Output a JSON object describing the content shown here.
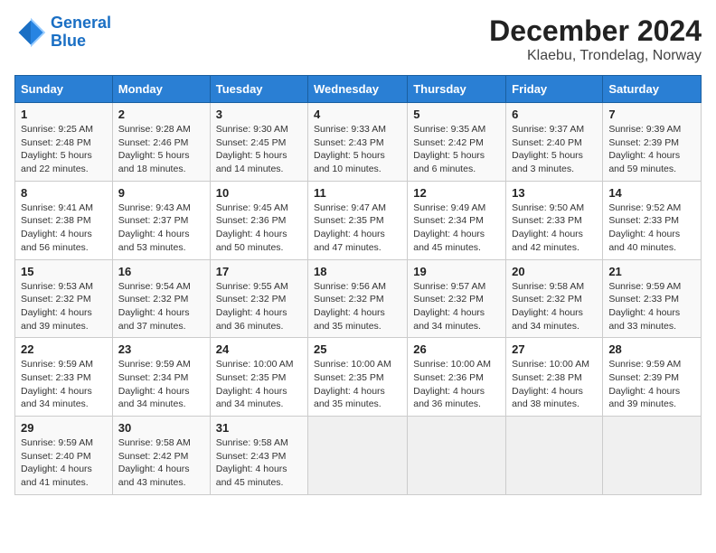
{
  "header": {
    "logo_line1": "General",
    "logo_line2": "Blue",
    "title": "December 2024",
    "subtitle": "Klaebu, Trondelag, Norway"
  },
  "columns": [
    "Sunday",
    "Monday",
    "Tuesday",
    "Wednesday",
    "Thursday",
    "Friday",
    "Saturday"
  ],
  "weeks": [
    [
      {
        "day": "1",
        "sunrise": "Sunrise: 9:25 AM",
        "sunset": "Sunset: 2:48 PM",
        "daylight": "Daylight: 5 hours and 22 minutes."
      },
      {
        "day": "2",
        "sunrise": "Sunrise: 9:28 AM",
        "sunset": "Sunset: 2:46 PM",
        "daylight": "Daylight: 5 hours and 18 minutes."
      },
      {
        "day": "3",
        "sunrise": "Sunrise: 9:30 AM",
        "sunset": "Sunset: 2:45 PM",
        "daylight": "Daylight: 5 hours and 14 minutes."
      },
      {
        "day": "4",
        "sunrise": "Sunrise: 9:33 AM",
        "sunset": "Sunset: 2:43 PM",
        "daylight": "Daylight: 5 hours and 10 minutes."
      },
      {
        "day": "5",
        "sunrise": "Sunrise: 9:35 AM",
        "sunset": "Sunset: 2:42 PM",
        "daylight": "Daylight: 5 hours and 6 minutes."
      },
      {
        "day": "6",
        "sunrise": "Sunrise: 9:37 AM",
        "sunset": "Sunset: 2:40 PM",
        "daylight": "Daylight: 5 hours and 3 minutes."
      },
      {
        "day": "7",
        "sunrise": "Sunrise: 9:39 AM",
        "sunset": "Sunset: 2:39 PM",
        "daylight": "Daylight: 4 hours and 59 minutes."
      }
    ],
    [
      {
        "day": "8",
        "sunrise": "Sunrise: 9:41 AM",
        "sunset": "Sunset: 2:38 PM",
        "daylight": "Daylight: 4 hours and 56 minutes."
      },
      {
        "day": "9",
        "sunrise": "Sunrise: 9:43 AM",
        "sunset": "Sunset: 2:37 PM",
        "daylight": "Daylight: 4 hours and 53 minutes."
      },
      {
        "day": "10",
        "sunrise": "Sunrise: 9:45 AM",
        "sunset": "Sunset: 2:36 PM",
        "daylight": "Daylight: 4 hours and 50 minutes."
      },
      {
        "day": "11",
        "sunrise": "Sunrise: 9:47 AM",
        "sunset": "Sunset: 2:35 PM",
        "daylight": "Daylight: 4 hours and 47 minutes."
      },
      {
        "day": "12",
        "sunrise": "Sunrise: 9:49 AM",
        "sunset": "Sunset: 2:34 PM",
        "daylight": "Daylight: 4 hours and 45 minutes."
      },
      {
        "day": "13",
        "sunrise": "Sunrise: 9:50 AM",
        "sunset": "Sunset: 2:33 PM",
        "daylight": "Daylight: 4 hours and 42 minutes."
      },
      {
        "day": "14",
        "sunrise": "Sunrise: 9:52 AM",
        "sunset": "Sunset: 2:33 PM",
        "daylight": "Daylight: 4 hours and 40 minutes."
      }
    ],
    [
      {
        "day": "15",
        "sunrise": "Sunrise: 9:53 AM",
        "sunset": "Sunset: 2:32 PM",
        "daylight": "Daylight: 4 hours and 39 minutes."
      },
      {
        "day": "16",
        "sunrise": "Sunrise: 9:54 AM",
        "sunset": "Sunset: 2:32 PM",
        "daylight": "Daylight: 4 hours and 37 minutes."
      },
      {
        "day": "17",
        "sunrise": "Sunrise: 9:55 AM",
        "sunset": "Sunset: 2:32 PM",
        "daylight": "Daylight: 4 hours and 36 minutes."
      },
      {
        "day": "18",
        "sunrise": "Sunrise: 9:56 AM",
        "sunset": "Sunset: 2:32 PM",
        "daylight": "Daylight: 4 hours and 35 minutes."
      },
      {
        "day": "19",
        "sunrise": "Sunrise: 9:57 AM",
        "sunset": "Sunset: 2:32 PM",
        "daylight": "Daylight: 4 hours and 34 minutes."
      },
      {
        "day": "20",
        "sunrise": "Sunrise: 9:58 AM",
        "sunset": "Sunset: 2:32 PM",
        "daylight": "Daylight: 4 hours and 34 minutes."
      },
      {
        "day": "21",
        "sunrise": "Sunrise: 9:59 AM",
        "sunset": "Sunset: 2:33 PM",
        "daylight": "Daylight: 4 hours and 33 minutes."
      }
    ],
    [
      {
        "day": "22",
        "sunrise": "Sunrise: 9:59 AM",
        "sunset": "Sunset: 2:33 PM",
        "daylight": "Daylight: 4 hours and 34 minutes."
      },
      {
        "day": "23",
        "sunrise": "Sunrise: 9:59 AM",
        "sunset": "Sunset: 2:34 PM",
        "daylight": "Daylight: 4 hours and 34 minutes."
      },
      {
        "day": "24",
        "sunrise": "Sunrise: 10:00 AM",
        "sunset": "Sunset: 2:35 PM",
        "daylight": "Daylight: 4 hours and 34 minutes."
      },
      {
        "day": "25",
        "sunrise": "Sunrise: 10:00 AM",
        "sunset": "Sunset: 2:35 PM",
        "daylight": "Daylight: 4 hours and 35 minutes."
      },
      {
        "day": "26",
        "sunrise": "Sunrise: 10:00 AM",
        "sunset": "Sunset: 2:36 PM",
        "daylight": "Daylight: 4 hours and 36 minutes."
      },
      {
        "day": "27",
        "sunrise": "Sunrise: 10:00 AM",
        "sunset": "Sunset: 2:38 PM",
        "daylight": "Daylight: 4 hours and 38 minutes."
      },
      {
        "day": "28",
        "sunrise": "Sunrise: 9:59 AM",
        "sunset": "Sunset: 2:39 PM",
        "daylight": "Daylight: 4 hours and 39 minutes."
      }
    ],
    [
      {
        "day": "29",
        "sunrise": "Sunrise: 9:59 AM",
        "sunset": "Sunset: 2:40 PM",
        "daylight": "Daylight: 4 hours and 41 minutes."
      },
      {
        "day": "30",
        "sunrise": "Sunrise: 9:58 AM",
        "sunset": "Sunset: 2:42 PM",
        "daylight": "Daylight: 4 hours and 43 minutes."
      },
      {
        "day": "31",
        "sunrise": "Sunrise: 9:58 AM",
        "sunset": "Sunset: 2:43 PM",
        "daylight": "Daylight: 4 hours and 45 minutes."
      },
      null,
      null,
      null,
      null
    ]
  ]
}
